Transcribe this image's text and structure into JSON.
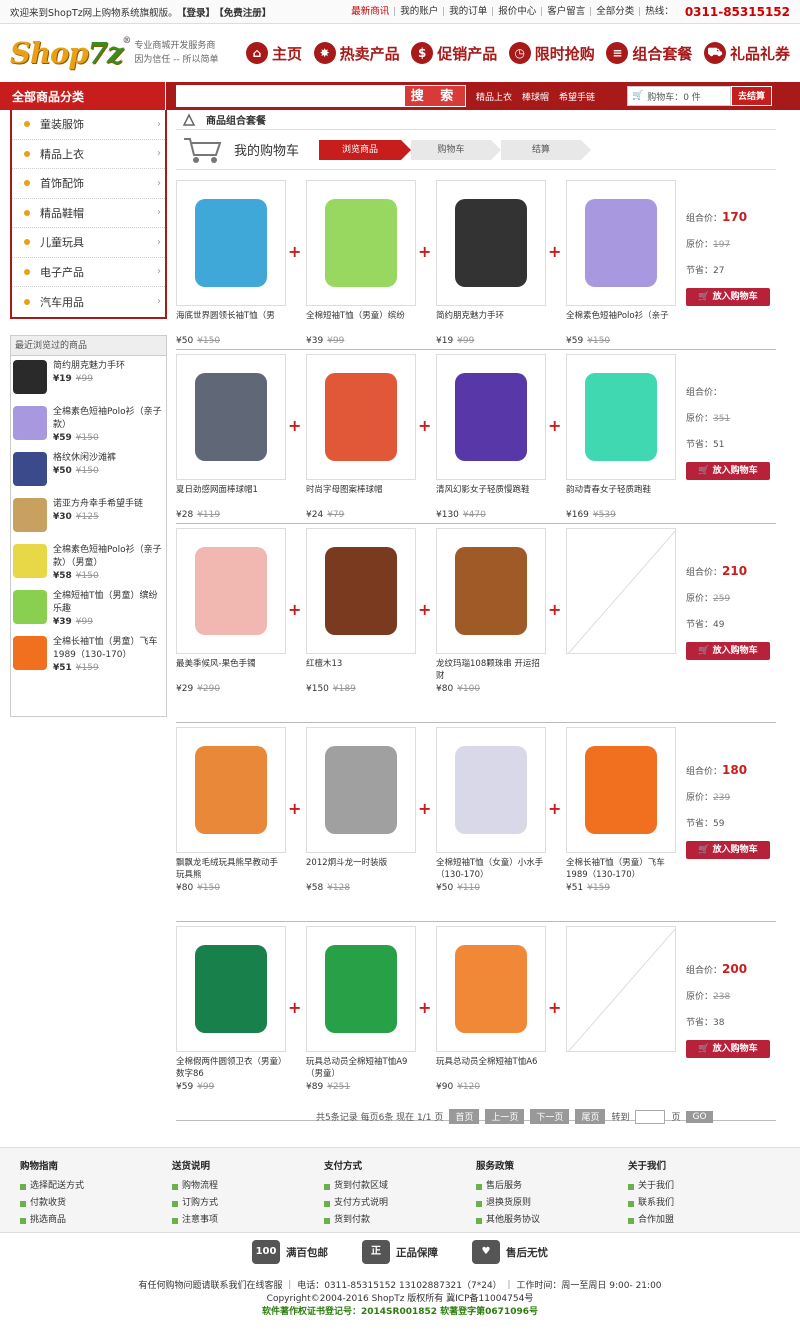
{
  "topbar": {
    "welcome": "欢迎来到ShopTz网上购物系统旗舰版。",
    "login": "【登录】",
    "register": "【免费注册】",
    "links": [
      "最新商讯",
      "我的账户",
      "我的订单",
      "报价中心",
      "客户留言",
      "全部分类"
    ],
    "hotline_label": "热线：",
    "hotline": "0311-85315152"
  },
  "logo": {
    "brand_a": "Shop",
    "brand_b": "7z",
    "reg": "®",
    "slogan1": "专业商城开发服务商",
    "slogan2": "因为信任 -- 所以简单"
  },
  "nav": [
    {
      "label": "主页",
      "icon": "home-icon"
    },
    {
      "label": "热卖产品",
      "icon": "fire-icon"
    },
    {
      "label": "促销产品",
      "icon": "dollar-icon"
    },
    {
      "label": "限时抢购",
      "icon": "clock-icon"
    },
    {
      "label": "组合套餐",
      "icon": "stack-icon"
    },
    {
      "label": "礼品礼券",
      "icon": "cart-icon"
    }
  ],
  "search": {
    "all_categories": "全部商品分类",
    "button": "搜 索",
    "placeholder": "",
    "hotwords": [
      "精品上衣",
      "棒球帽",
      "希望手链"
    ],
    "cart": "购物车：0 件",
    "settle": "去结算"
  },
  "categories": [
    "童装服饰",
    "精品上衣",
    "首饰配饰",
    "精品鞋帽",
    "儿童玩具",
    "电子产品",
    "汽车用品"
  ],
  "recent": {
    "title": "最近浏览过的商品",
    "items": [
      {
        "name": "简约朋克魅力手环",
        "price": "¥19",
        "old": "¥99",
        "color": "#2a2a2a"
      },
      {
        "name": "全棉素色短袖Polo衫（亲子款）",
        "price": "¥59",
        "old": "¥150",
        "color": "#a898e0"
      },
      {
        "name": "格纹休闲沙滩裤",
        "price": "¥50",
        "old": "¥150",
        "color": "#3a4a8a"
      },
      {
        "name": "诺亚方舟幸手希望手链",
        "price": "¥30",
        "old": "¥125",
        "color": "#c8a060"
      },
      {
        "name": "全棉素色短袖Polo衫（亲子款）（男童）",
        "price": "¥58",
        "old": "¥150",
        "color": "#e8d848"
      },
      {
        "name": "全棉短袖T恤（男童）缤纷乐趣",
        "price": "¥39",
        "old": "¥99",
        "color": "#8ad050"
      },
      {
        "name": "全棉长袖T恤（男童）飞车1989（130-170）",
        "price": "¥51",
        "old": "¥159",
        "color": "#f07020"
      }
    ]
  },
  "main": {
    "crumb": "商品组合套餐",
    "cart_title": "我的购物车",
    "steps": [
      "浏览商品",
      "购物车",
      "结算"
    ]
  },
  "combos": [
    {
      "total_label": "组合价：",
      "total": "170",
      "orig_label": "原价：",
      "orig": "197",
      "save_label": "节省：",
      "save": "27",
      "add": "放入购物车",
      "products": [
        {
          "name": "海底世界圆领长袖T恤（男",
          "price": "¥50",
          "old": "¥150",
          "color": "#40a8d8"
        },
        {
          "name": "全棉短袖T恤（男童）缤纷",
          "price": "¥39",
          "old": "¥99",
          "color": "#98d860"
        },
        {
          "name": "简约朋克魅力手环",
          "price": "¥19",
          "old": "¥99",
          "color": "#333333"
        },
        {
          "name": "全棉素色短袖Polo衫（亲子",
          "price": "¥59",
          "old": "¥150",
          "color": "#a898e0"
        }
      ]
    },
    {
      "total_label": "组合价：",
      "total": "",
      "orig_label": "原价：",
      "orig": "351",
      "save_label": "节省：",
      "save": "51",
      "add": "放入购物车",
      "products": [
        {
          "name": "夏日劲感网面棒球帽1",
          "price": "¥28",
          "old": "¥119",
          "color": "#606878"
        },
        {
          "name": "时尚字母图案棒球帽",
          "price": "¥24",
          "old": "¥79",
          "color": "#e05838"
        },
        {
          "name": "清风幻影女子轻质慢跑鞋",
          "price": "¥130",
          "old": "¥470",
          "color": "#5838a8"
        },
        {
          "name": "韵动青春女子轻质跑鞋",
          "price": "¥169",
          "old": "¥539",
          "color": "#40d8b0"
        }
      ]
    },
    {
      "total_label": "组合价：",
      "total": "210",
      "orig_label": "原价：",
      "orig": "259",
      "save_label": "节省：",
      "save": "49",
      "add": "放入购物车",
      "products": [
        {
          "name": "最美季候风-果色手镯",
          "price": "¥29",
          "old": "¥290",
          "color": "#f0b8b0"
        },
        {
          "name": "红檀木13",
          "price": "¥150",
          "old": "¥189",
          "color": "#7a3a20"
        },
        {
          "name": "龙纹玛瑙108颗珠串 开运招财",
          "price": "¥80",
          "old": "¥100",
          "color": "#a05a28"
        },
        {
          "name": "",
          "price": "",
          "old": "",
          "color": ""
        }
      ]
    },
    {
      "total_label": "组合价：",
      "total": "180",
      "orig_label": "原价：",
      "orig": "239",
      "save_label": "节省：",
      "save": "59",
      "add": "放入购物车",
      "products": [
        {
          "name": "飘飘龙毛绒玩具熊早教动手玩具熊",
          "price": "¥80",
          "old": "¥150",
          "color": "#e88838"
        },
        {
          "name": "2012炯斗龙一时装版",
          "price": "¥58",
          "old": "¥128",
          "color": "#a0a0a0"
        },
        {
          "name": "全棉短袖T恤（女童）小水手（130-170）",
          "price": "¥50",
          "old": "¥110",
          "color": "#d8d8e8"
        },
        {
          "name": "全棉长袖T恤（男童）飞车1989（130-170）",
          "price": "¥51",
          "old": "¥159",
          "color": "#f07020"
        }
      ]
    },
    {
      "total_label": "组合价：",
      "total": "200",
      "orig_label": "原价：",
      "orig": "238",
      "save_label": "节省：",
      "save": "38",
      "add": "放入购物车",
      "products": [
        {
          "name": "全棉假两件圆领卫衣（男童）数字86",
          "price": "¥59",
          "old": "¥99",
          "color": "#18804a"
        },
        {
          "name": "玩具总动员全棉短袖T恤A9（男童）",
          "price": "¥89",
          "old": "¥251",
          "color": "#28a048"
        },
        {
          "name": "玩具总动员全棉短袖T恤A6",
          "price": "¥90",
          "old": "¥120",
          "color": "#f08838"
        },
        {
          "name": "",
          "price": "",
          "old": "",
          "color": ""
        }
      ]
    }
  ],
  "pager": {
    "info": "共5条记录 每页6条 现在 1/1 页",
    "first": "首页",
    "prev": "上一页",
    "next": "下一页",
    "last": "尾页",
    "goto": "转到",
    "page": "页",
    "go": "GO"
  },
  "footer": {
    "cols": [
      {
        "title": "购物指南",
        "items": [
          "选择配送方式",
          "付款收货",
          "挑选商品"
        ]
      },
      {
        "title": "送货说明",
        "items": [
          "购物流程",
          "订购方式",
          "注意事项"
        ]
      },
      {
        "title": "支付方式",
        "items": [
          "货到付款区域",
          "支付方式说明",
          "货到付款"
        ]
      },
      {
        "title": "服务政策",
        "items": [
          "售后服务",
          "退换货原则",
          "其他服务协议"
        ]
      },
      {
        "title": "关于我们",
        "items": [
          "关于我们",
          "联系我们",
          "合作加盟"
        ]
      }
    ],
    "guarantees": [
      {
        "label": "满百包邮",
        "icon": "truck-icon",
        "glyph": "100"
      },
      {
        "label": "正品保障",
        "icon": "shield-icon",
        "glyph": "正"
      },
      {
        "label": "售后无忧",
        "icon": "handshake-icon",
        "glyph": "♥"
      }
    ],
    "line1": "有任何购物问题请联系我们在线客服 ｜ 电话：0311-85315152 13102887321（7*24） ｜ 工作时间：周一至周日 9:00- 21:00",
    "line2": "Copyright©2004-2016 ShopTz 版权所有 冀ICP备11004754号",
    "line3": "软件著作权证书登记号：2014SR001852 软著登字第0671096号"
  }
}
